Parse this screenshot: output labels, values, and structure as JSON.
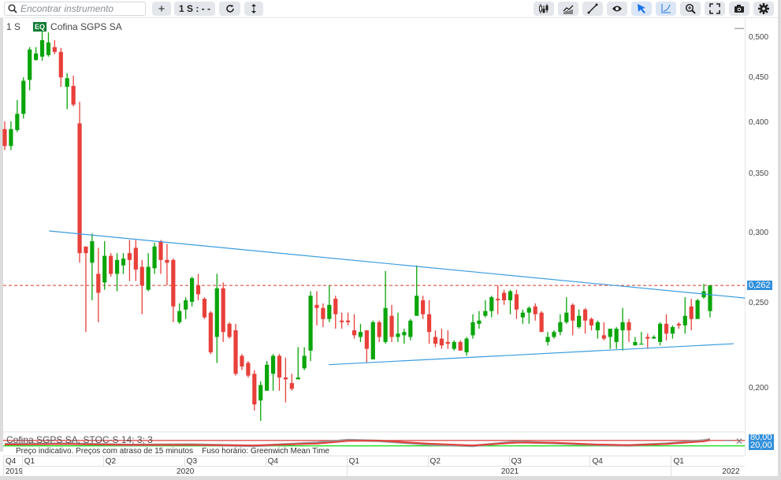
{
  "toolbar": {
    "search_placeholder": "Encontrar instrumento",
    "add_label": "+",
    "interval_label": "1 S : - -",
    "left_icons": [
      "plus-icon",
      "refresh-icon",
      "vertical-arrows-icon"
    ],
    "right_icons": [
      "candlestick-icon",
      "area-chart-icon",
      "trend-line-icon",
      "eye-icon",
      "cursor-arrow-icon",
      "curve-icon",
      "zoom-in-icon",
      "fullscreen-icon",
      "camera-icon",
      "gear-icon"
    ]
  },
  "header": {
    "interval": "1 S",
    "type_badge": "EQ",
    "instrument": "Cofina SGPS SA",
    "minimize": "—"
  },
  "indicator": {
    "label": "Cofina SGPS SA, STOC-S 14; 3; 3",
    "upper_label": "80,00",
    "lower_label": "20,00",
    "minimize": "—",
    "close": "✕"
  },
  "status_text": "Preço indicativo. Preços com atraso de 15 minutos    Fuso horário: Greenwich Mean Time",
  "colors": {
    "up": "#0aa50a",
    "down": "#e8403a",
    "trendline": "#3a9ce0",
    "last_price": "#d63a30",
    "badge": "#3390dc"
  },
  "chart_data": {
    "type": "candlestick",
    "instrument": "Cofina SGPS SA",
    "interval": "1 S",
    "y_scale": "log",
    "ylim": [
      0.18,
      0.515
    ],
    "y_ticks": [
      {
        "value": 0.5,
        "label": "0,500"
      },
      {
        "value": 0.45,
        "label": "0,450"
      },
      {
        "value": 0.4,
        "label": "0,400"
      },
      {
        "value": 0.35,
        "label": "0,350"
      },
      {
        "value": 0.3,
        "label": "0,300"
      },
      {
        "value": 0.25,
        "label": "0,250"
      },
      {
        "value": 0.2,
        "label": "0,200"
      }
    ],
    "last_price": {
      "value": 0.262,
      "label": "0,262"
    },
    "x_quarters": [
      {
        "label": "Q4",
        "index": -1
      },
      {
        "label": "Q1",
        "index": 3
      },
      {
        "label": "Q2",
        "index": 16
      },
      {
        "label": "Q3",
        "index": 29
      },
      {
        "label": "Q4",
        "index": 42
      },
      {
        "label": "Q1",
        "index": 55
      },
      {
        "label": "Q2",
        "index": 68
      },
      {
        "label": "Q3",
        "index": 81
      },
      {
        "label": "Q4",
        "index": 94
      },
      {
        "label": "Q1",
        "index": 107
      }
    ],
    "x_years": [
      {
        "label": "2019",
        "start": -1,
        "end": 3
      },
      {
        "label": "2020",
        "start": 3,
        "end": 55
      },
      {
        "label": "2021",
        "start": 55,
        "end": 107
      },
      {
        "label": "2022",
        "start": 107,
        "end": 118
      }
    ],
    "candles_ohlc": [
      [
        0.394,
        0.402,
        0.373,
        0.377
      ],
      [
        0.377,
        0.402,
        0.373,
        0.394
      ],
      [
        0.393,
        0.425,
        0.391,
        0.41
      ],
      [
        0.41,
        0.451,
        0.405,
        0.447
      ],
      [
        0.448,
        0.488,
        0.436,
        0.485
      ],
      [
        0.472,
        0.488,
        0.471,
        0.48
      ],
      [
        0.476,
        0.508,
        0.471,
        0.497
      ],
      [
        0.478,
        0.507,
        0.476,
        0.494
      ],
      [
        0.488,
        0.497,
        0.479,
        0.482
      ],
      [
        0.482,
        0.487,
        0.44,
        0.451
      ],
      [
        0.44,
        0.456,
        0.415,
        0.45
      ],
      [
        0.441,
        0.453,
        0.418,
        0.42
      ],
      [
        0.4,
        0.423,
        0.278,
        0.285
      ],
      [
        0.29,
        0.29,
        0.232,
        0.285
      ],
      [
        0.278,
        0.3,
        0.252,
        0.294
      ],
      [
        0.27,
        0.289,
        0.238,
        0.257
      ],
      [
        0.264,
        0.294,
        0.259,
        0.283
      ],
      [
        0.283,
        0.285,
        0.268,
        0.27
      ],
      [
        0.27,
        0.285,
        0.258,
        0.28
      ],
      [
        0.276,
        0.285,
        0.27,
        0.281
      ],
      [
        0.285,
        0.295,
        0.265,
        0.28
      ],
      [
        0.289,
        0.295,
        0.265,
        0.273
      ],
      [
        0.275,
        0.28,
        0.243,
        0.262
      ],
      [
        0.259,
        0.285,
        0.258,
        0.275
      ],
      [
        0.274,
        0.293,
        0.27,
        0.29
      ],
      [
        0.294,
        0.295,
        0.27,
        0.28
      ],
      [
        0.28,
        0.292,
        0.262,
        0.278
      ],
      [
        0.28,
        0.281,
        0.238,
        0.248
      ],
      [
        0.238,
        0.25,
        0.237,
        0.245
      ],
      [
        0.246,
        0.254,
        0.24,
        0.252
      ],
      [
        0.251,
        0.268,
        0.248,
        0.267
      ],
      [
        0.262,
        0.27,
        0.252,
        0.256
      ],
      [
        0.253,
        0.254,
        0.24,
        0.241
      ],
      [
        0.244,
        0.245,
        0.219,
        0.22
      ],
      [
        0.229,
        0.27,
        0.214,
        0.26
      ],
      [
        0.26,
        0.264,
        0.226,
        0.232
      ],
      [
        0.237,
        0.238,
        0.228,
        0.229
      ],
      [
        0.233,
        0.237,
        0.207,
        0.208
      ],
      [
        0.218,
        0.219,
        0.21,
        0.212
      ],
      [
        0.214,
        0.215,
        0.206,
        0.207
      ],
      [
        0.208,
        0.21,
        0.189,
        0.192
      ],
      [
        0.194,
        0.204,
        0.184,
        0.202
      ],
      [
        0.199,
        0.215,
        0.199,
        0.213
      ],
      [
        0.208,
        0.219,
        0.199,
        0.218
      ],
      [
        0.218,
        0.219,
        0.199,
        0.206
      ],
      [
        0.206,
        0.217,
        0.193,
        0.205
      ],
      [
        0.203,
        0.208,
        0.199,
        0.2
      ],
      [
        0.205,
        0.223,
        0.205,
        0.206
      ],
      [
        0.211,
        0.223,
        0.21,
        0.218
      ],
      [
        0.221,
        0.258,
        0.215,
        0.255
      ],
      [
        0.249,
        0.258,
        0.236,
        0.247
      ],
      [
        0.247,
        0.25,
        0.235,
        0.24
      ],
      [
        0.24,
        0.262,
        0.238,
        0.249
      ],
      [
        0.253,
        0.255,
        0.234,
        0.243
      ],
      [
        0.239,
        0.244,
        0.234,
        0.238
      ],
      [
        0.239,
        0.244,
        0.236,
        0.238
      ],
      [
        0.233,
        0.243,
        0.228,
        0.23
      ],
      [
        0.229,
        0.237,
        0.226,
        0.232
      ],
      [
        0.233,
        0.233,
        0.214,
        0.222
      ],
      [
        0.216,
        0.239,
        0.216,
        0.238
      ],
      [
        0.238,
        0.239,
        0.226,
        0.229
      ],
      [
        0.226,
        0.272,
        0.225,
        0.247
      ],
      [
        0.242,
        0.249,
        0.226,
        0.229
      ],
      [
        0.229,
        0.244,
        0.226,
        0.231
      ],
      [
        0.23,
        0.234,
        0.225,
        0.232
      ],
      [
        0.229,
        0.24,
        0.227,
        0.239
      ],
      [
        0.242,
        0.276,
        0.242,
        0.255
      ],
      [
        0.252,
        0.255,
        0.24,
        0.243
      ],
      [
        0.243,
        0.252,
        0.225,
        0.232
      ],
      [
        0.229,
        0.233,
        0.223,
        0.225
      ],
      [
        0.228,
        0.234,
        0.222,
        0.224
      ],
      [
        0.226,
        0.233,
        0.222,
        0.225
      ],
      [
        0.222,
        0.227,
        0.221,
        0.226
      ],
      [
        0.226,
        0.227,
        0.221,
        0.221
      ],
      [
        0.22,
        0.229,
        0.218,
        0.228
      ],
      [
        0.23,
        0.243,
        0.228,
        0.238
      ],
      [
        0.237,
        0.245,
        0.234,
        0.239
      ],
      [
        0.242,
        0.252,
        0.241,
        0.245
      ],
      [
        0.245,
        0.255,
        0.241,
        0.254
      ],
      [
        0.253,
        0.262,
        0.243,
        0.252
      ],
      [
        0.257,
        0.259,
        0.249,
        0.252
      ],
      [
        0.252,
        0.259,
        0.243,
        0.258
      ],
      [
        0.256,
        0.259,
        0.24,
        0.246
      ],
      [
        0.241,
        0.246,
        0.237,
        0.244
      ],
      [
        0.244,
        0.248,
        0.237,
        0.247
      ],
      [
        0.248,
        0.25,
        0.239,
        0.243
      ],
      [
        0.244,
        0.245,
        0.232,
        0.232
      ],
      [
        0.226,
        0.232,
        0.224,
        0.229
      ],
      [
        0.229,
        0.233,
        0.228,
        0.232
      ],
      [
        0.232,
        0.243,
        0.23,
        0.238
      ],
      [
        0.238,
        0.254,
        0.237,
        0.244
      ],
      [
        0.249,
        0.25,
        0.23,
        0.239
      ],
      [
        0.235,
        0.246,
        0.234,
        0.242
      ],
      [
        0.246,
        0.247,
        0.231,
        0.239
      ],
      [
        0.24,
        0.241,
        0.233,
        0.236
      ],
      [
        0.233,
        0.239,
        0.228,
        0.238
      ],
      [
        0.23,
        0.238,
        0.227,
        0.228
      ],
      [
        0.229,
        0.234,
        0.222,
        0.234
      ],
      [
        0.226,
        0.235,
        0.222,
        0.234
      ],
      [
        0.233,
        0.247,
        0.221,
        0.238
      ],
      [
        0.238,
        0.24,
        0.226,
        0.233
      ],
      [
        0.224,
        0.229,
        0.224,
        0.226
      ],
      [
        0.225,
        0.232,
        0.225,
        0.225
      ],
      [
        0.229,
        0.231,
        0.222,
        0.228
      ],
      [
        0.228,
        0.23,
        0.228,
        0.229
      ],
      [
        0.226,
        0.238,
        0.224,
        0.237
      ],
      [
        0.237,
        0.243,
        0.227,
        0.231
      ],
      [
        0.231,
        0.236,
        0.228,
        0.235
      ],
      [
        0.237,
        0.238,
        0.234,
        0.236
      ],
      [
        0.236,
        0.254,
        0.231,
        0.242
      ],
      [
        0.248,
        0.253,
        0.233,
        0.24
      ],
      [
        0.24,
        0.253,
        0.24,
        0.252
      ],
      [
        0.254,
        0.263,
        0.253,
        0.258
      ],
      [
        0.245,
        0.262,
        0.241,
        0.262
      ]
    ],
    "trendlines": [
      {
        "from": {
          "index": 7.1,
          "price": 0.302
        },
        "to": {
          "index": 118.6,
          "price": 0.2535
        }
      },
      {
        "from": {
          "index": 51.9,
          "price": 0.213
        },
        "to": {
          "index": 116.8,
          "price": 0.225
        }
      }
    ],
    "stochastic": {
      "levels": [
        80,
        20
      ],
      "k": [
        [
          0,
          40
        ],
        [
          10,
          45
        ],
        [
          20,
          30
        ],
        [
          30,
          35
        ],
        [
          40,
          20
        ],
        [
          50,
          55
        ],
        [
          55,
          85
        ],
        [
          60,
          75
        ],
        [
          68,
          35
        ],
        [
          75,
          20
        ],
        [
          82,
          65
        ],
        [
          88,
          50
        ],
        [
          95,
          30
        ],
        [
          100,
          25
        ],
        [
          106,
          45
        ],
        [
          112,
          80
        ],
        [
          113,
          92
        ]
      ],
      "d": [
        [
          0,
          35
        ],
        [
          10,
          40
        ],
        [
          20,
          32
        ],
        [
          30,
          30
        ],
        [
          40,
          25
        ],
        [
          50,
          45
        ],
        [
          55,
          75
        ],
        [
          60,
          78
        ],
        [
          68,
          45
        ],
        [
          75,
          25
        ],
        [
          82,
          55
        ],
        [
          88,
          55
        ],
        [
          95,
          35
        ],
        [
          100,
          28
        ],
        [
          106,
          40
        ],
        [
          112,
          70
        ],
        [
          113,
          85
        ]
      ]
    }
  }
}
